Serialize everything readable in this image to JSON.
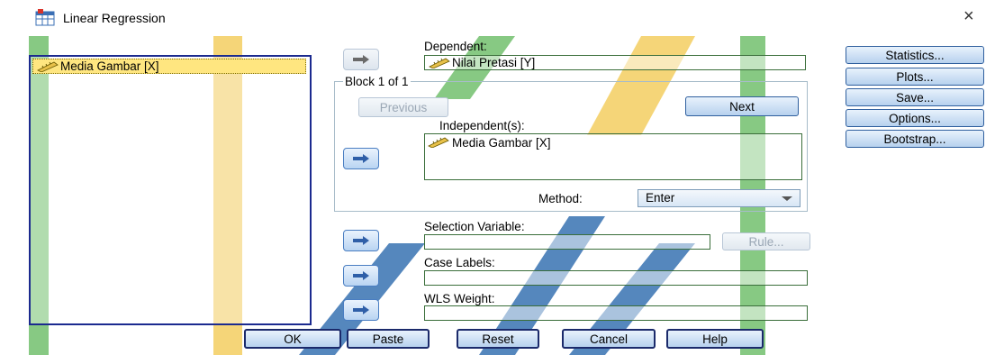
{
  "window": {
    "title": "Linear Regression",
    "close_symbol": "×"
  },
  "source_list": {
    "items": [
      {
        "label": "Media Gambar [X]"
      }
    ]
  },
  "dependent": {
    "label": "Dependent:",
    "value": "Nilai Pretasi [Y]"
  },
  "block": {
    "title": "Block 1 of 1",
    "previous_label": "Previous",
    "next_label": "Next"
  },
  "independent": {
    "label": "Independent(s):",
    "items": [
      {
        "label": "Media Gambar [X]"
      }
    ]
  },
  "method": {
    "label": "Method:",
    "selected": "Enter"
  },
  "selection_variable": {
    "label": "Selection Variable:",
    "value": "",
    "rule_label": "Rule..."
  },
  "case_labels": {
    "label": "Case Labels:",
    "value": ""
  },
  "wls_weight": {
    "label": "WLS Weight:",
    "value": ""
  },
  "side_buttons": {
    "statistics": "Statistics...",
    "plots": "Plots...",
    "save": "Save...",
    "options": "Options...",
    "bootstrap": "Bootstrap..."
  },
  "bottom_buttons": {
    "ok": "OK",
    "paste": "Paste",
    "reset": "Reset",
    "cancel": "Cancel",
    "help": "Help"
  },
  "colors": {
    "accent": "#4a7ec2",
    "selection": "#ffe680",
    "watermark_yellow": "#f2c84b",
    "watermark_green": "#5fb85a",
    "watermark_blue": "#1d5fa8"
  },
  "icons": {
    "app": "spss-table-icon",
    "arrow": "right-arrow-icon",
    "variable": "ruler-scale-icon"
  }
}
